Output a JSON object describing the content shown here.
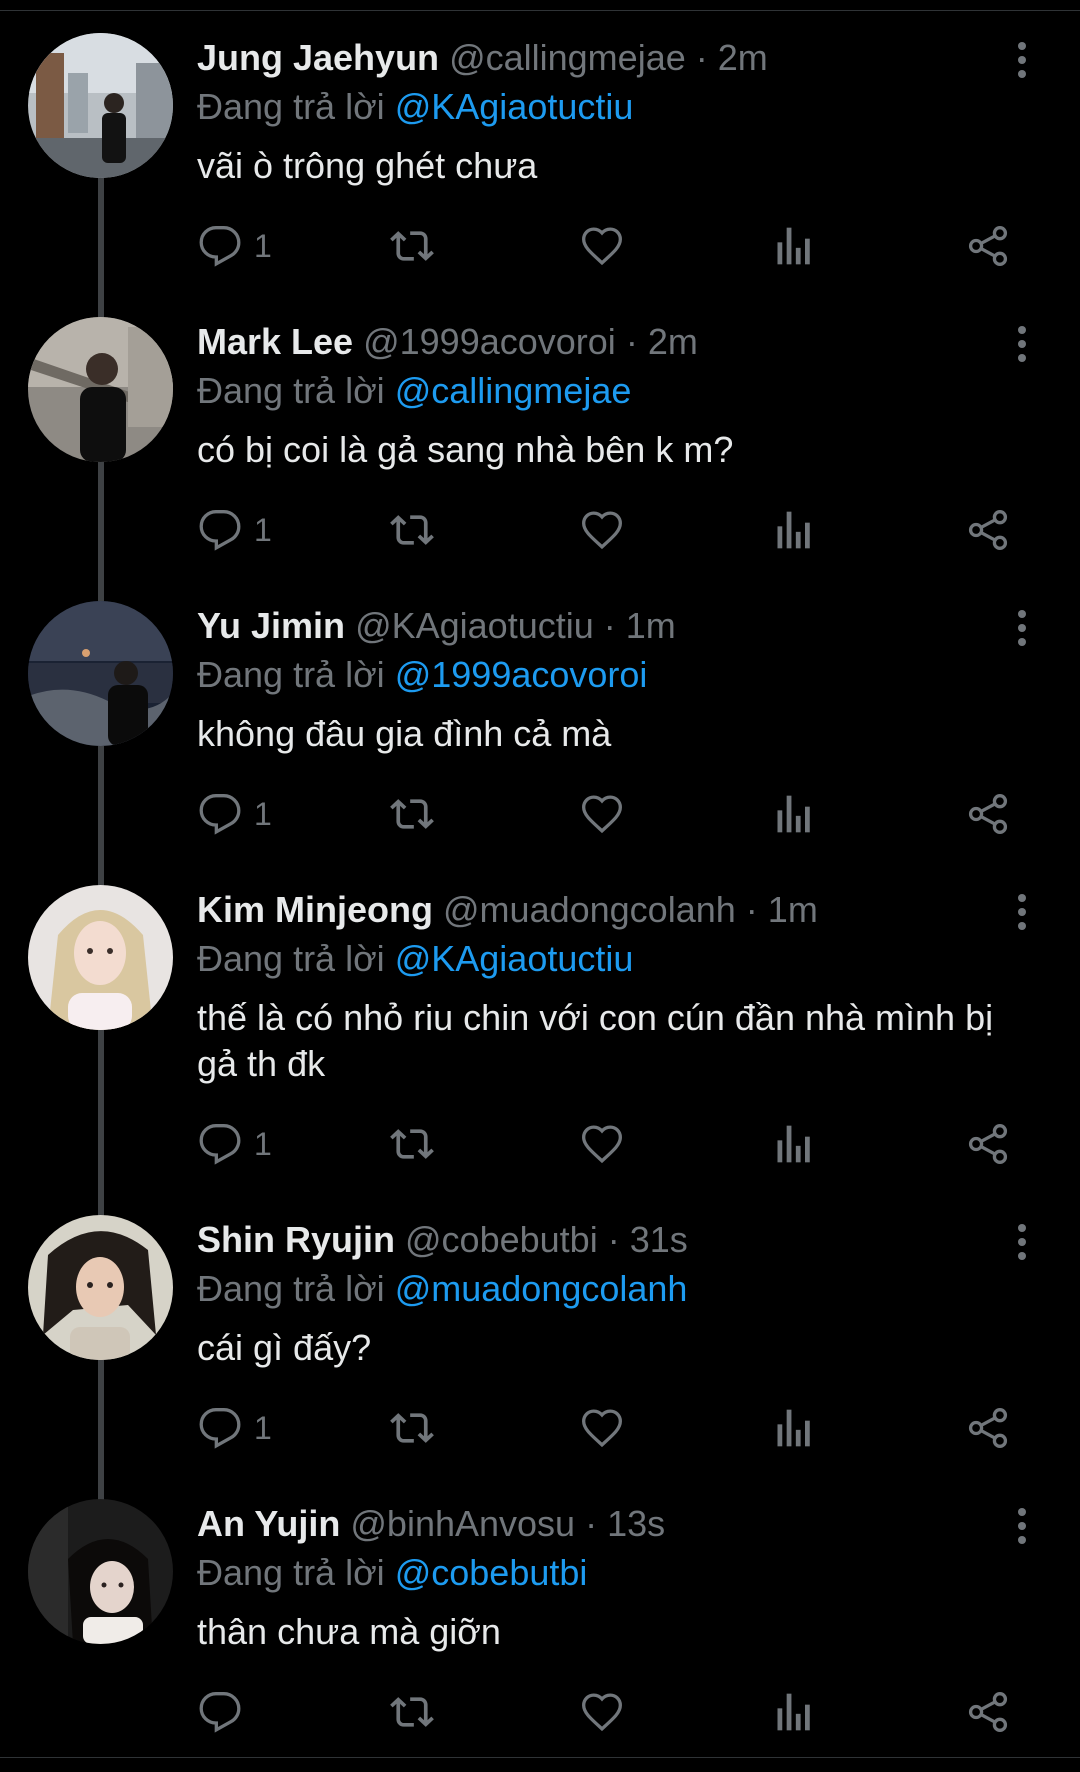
{
  "reply_prefix": "Đang trả lời",
  "tweets": [
    {
      "name": "Jung Jaehyun",
      "handle": "@callingmejae",
      "separator": "·",
      "time": "2m",
      "reply_to": "@KAgiaotuctiu",
      "text": "vãi ò trông ghét chưa",
      "reply_count": "1"
    },
    {
      "name": "Mark Lee",
      "handle": "@1999acovoroi",
      "separator": "·",
      "time": "2m",
      "reply_to": "@callingmejae",
      "text": "có bị coi là gả sang nhà bên k m?",
      "reply_count": "1"
    },
    {
      "name": "Yu Jimin",
      "handle": "@KAgiaotuctiu",
      "separator": "·",
      "time": "1m",
      "reply_to": "@1999acovoroi",
      "text": "không đâu gia đình cả mà",
      "reply_count": "1"
    },
    {
      "name": "Kim Minjeong",
      "handle": "@muadongcolanh",
      "separator": "·",
      "time": "1m",
      "reply_to": "@KAgiaotuctiu",
      "text": "thế là có nhỏ riu chin với con cún đần nhà mình bị gả th đk",
      "reply_count": "1"
    },
    {
      "name": "Shin Ryujin",
      "handle": "@cobebutbi",
      "separator": "·",
      "time": "31s",
      "reply_to": "@muadongcolanh",
      "text": "cái gì đấy?",
      "reply_count": "1"
    },
    {
      "name": "An Yujin",
      "handle": "@binhAnvosu",
      "separator": "·",
      "time": "13s",
      "reply_to": "@cobebutbi",
      "text": "thân chưa mà giỡn",
      "reply_count": ""
    }
  ],
  "icons": {
    "reply": "reply-icon",
    "retweet": "retweet-icon",
    "like": "like-icon",
    "views": "views-icon",
    "share": "share-icon",
    "more": "more-options-icon"
  },
  "colors": {
    "background": "#000000",
    "text": "#e7e9ea",
    "secondary": "#71767b",
    "mention": "#1d9bf0",
    "thread_line": "#3e4144"
  }
}
